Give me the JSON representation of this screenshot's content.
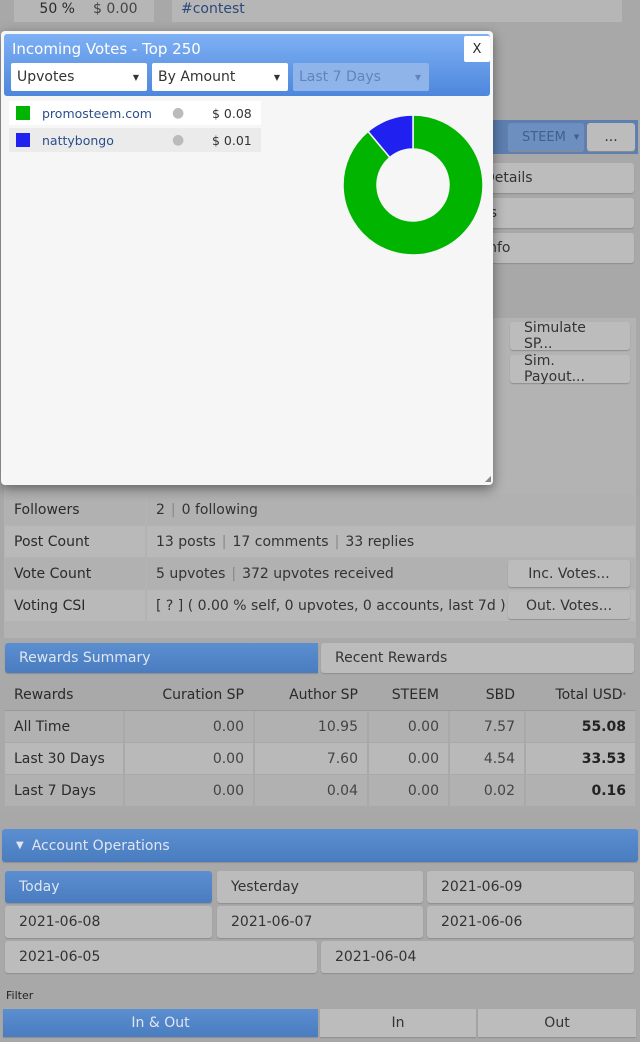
{
  "background": {
    "top_row": {
      "percent": "50 %",
      "amount": "$ 0.00",
      "tag": "#contest"
    },
    "currency_select": "STEEM",
    "more_button": "...",
    "side_buttons": [
      "Details",
      "rs",
      "Info"
    ],
    "simulate_sp": "Simulate SP...",
    "sim_payout": "Sim. Payout..."
  },
  "stats": [
    {
      "label": "Followers",
      "parts": [
        "2",
        "0 following"
      ]
    },
    {
      "label": "Post Count",
      "parts": [
        "13 posts",
        "17 comments",
        "33 replies"
      ]
    },
    {
      "label": "Vote Count",
      "parts": [
        "5 upvotes",
        "372 upvotes received"
      ],
      "button": "Inc. Votes..."
    },
    {
      "label": "Voting CSI",
      "parts": [
        "[ ? ] ( 0.00 % self, 0 upvotes, 0 accounts, last 7d )"
      ],
      "button": "Out. Votes..."
    }
  ],
  "rewards": {
    "tabs": [
      "Rewards Summary",
      "Recent Rewards"
    ],
    "headers": [
      "Rewards",
      "Curation SP",
      "Author SP",
      "STEEM",
      "SBD",
      "Total USD"
    ],
    "header_mark": "*",
    "rows": [
      [
        "All Time",
        "0.00",
        "10.95",
        "0.00",
        "7.57",
        "55.08"
      ],
      [
        "Last 30 Days",
        "0.00",
        "7.60",
        "0.00",
        "4.54",
        "33.53"
      ],
      [
        "Last 7 Days",
        "0.00",
        "0.04",
        "0.00",
        "0.02",
        "0.16"
      ]
    ]
  },
  "operations": {
    "title": "Account Operations",
    "days": [
      "Today",
      "Yesterday",
      "2021-06-09",
      "2021-06-08",
      "2021-06-07",
      "2021-06-06",
      "2021-06-05",
      "2021-06-04"
    ],
    "filter_label": "Filter",
    "filters": [
      "In & Out",
      "In",
      "Out"
    ]
  },
  "modal": {
    "title": "Incoming Votes - Top 250",
    "close": "X",
    "selects": [
      "Upvotes",
      "By Amount",
      "Last 7 Days"
    ],
    "voters": [
      {
        "name": "promosteem.com",
        "amount": "$ 0.08",
        "color": "#00b400",
        "icon": "user-icon"
      },
      {
        "name": "nattybongo",
        "amount": "$ 0.01",
        "color": "#2020f0",
        "icon": "user-icon"
      }
    ]
  },
  "chart_data": {
    "type": "pie",
    "donut": true,
    "categories": [
      "promosteem.com",
      "nattybongo"
    ],
    "values": [
      0.08,
      0.01
    ],
    "colors": [
      "#00b400",
      "#2020f0"
    ]
  }
}
